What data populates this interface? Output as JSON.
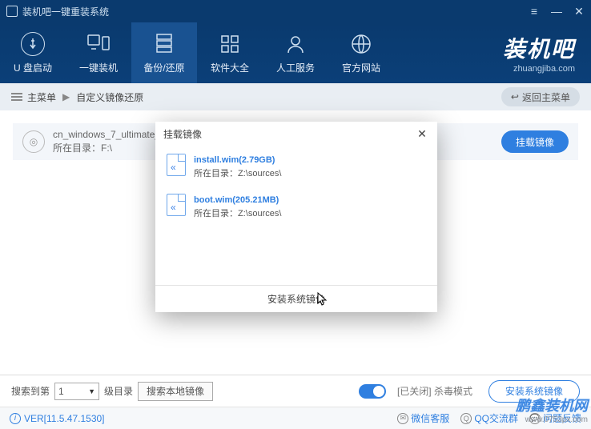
{
  "titlebar": {
    "title": "装机吧一键重装系统"
  },
  "nav": {
    "items": [
      {
        "label": "U 盘启动"
      },
      {
        "label": "一键装机"
      },
      {
        "label": "备份/还原"
      },
      {
        "label": "软件大全"
      },
      {
        "label": "人工服务"
      },
      {
        "label": "官方网站"
      }
    ]
  },
  "brand": {
    "cn": "装机吧",
    "en": "zhuangjiba.com"
  },
  "breadcrumb": {
    "root": "主菜单",
    "current": "自定义镜像还原",
    "back_label": "返回主菜单"
  },
  "file": {
    "name": "cn_windows_7_ultimate_v",
    "path_label": "所在目录：F:\\",
    "mount_btn": "挂载镜像"
  },
  "modal": {
    "title": "挂载镜像",
    "items": [
      {
        "name": "install.wim(2.79GB)",
        "path": "所在目录：Z:\\sources\\"
      },
      {
        "name": "boot.wim(205.21MB)",
        "path": "所在目录：Z:\\sources\\"
      }
    ],
    "footer_btn": "安装系统镜像"
  },
  "bottom": {
    "search_prefix": "搜索到第",
    "combo_value": "1",
    "search_suffix": "级目录",
    "search_btn": "搜索本地镜像",
    "kill_label": "[已关闭] 杀毒模式",
    "install_btn": "安装系统镜像"
  },
  "status": {
    "version": "VER[11.5.47.1530]",
    "links": [
      {
        "label": "微信客服"
      },
      {
        "label": "QQ交流群"
      },
      {
        "label": "问题反馈"
      }
    ]
  },
  "watermark": {
    "text": "鹏鑫装机网",
    "url": "www.0753px.com"
  }
}
